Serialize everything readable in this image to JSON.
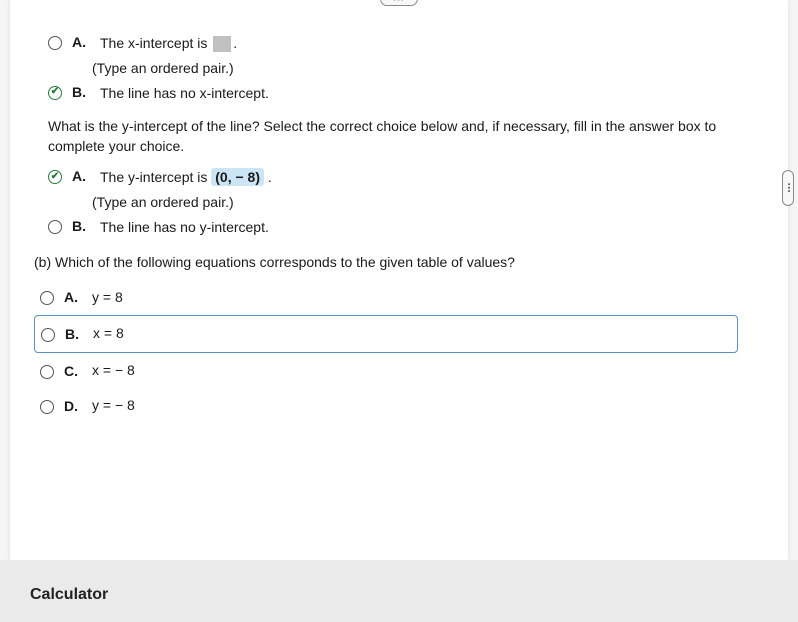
{
  "handles": {
    "top": "•••",
    "right": "•••"
  },
  "section_x": {
    "options": [
      {
        "letter": "A.",
        "text_prefix": "The x-intercept is",
        "text_suffix": ".",
        "hint": "(Type an ordered pair.)",
        "selected": false
      },
      {
        "letter": "B.",
        "text": "The line has no x-intercept.",
        "selected": true
      }
    ]
  },
  "question_y": "What is the y-intercept of the line? Select the correct choice below and, if necessary, fill in the answer box to complete your choice.",
  "section_y": {
    "options": [
      {
        "letter": "A.",
        "text_prefix": "The y-intercept is",
        "value": "(0, − 8)",
        "text_suffix": ".",
        "hint": "(Type an ordered pair.)",
        "selected": true
      },
      {
        "letter": "B.",
        "text": "The line has no y-intercept.",
        "selected": false
      }
    ]
  },
  "question_b": "(b) Which of the following equations corresponds to the given table of values?",
  "section_b": {
    "options": [
      {
        "letter": "A.",
        "text": "y = 8",
        "selected": false,
        "highlighted": false
      },
      {
        "letter": "B.",
        "text": "x = 8",
        "selected": false,
        "highlighted": true
      },
      {
        "letter": "C.",
        "text": "x = − 8",
        "selected": false,
        "highlighted": false
      },
      {
        "letter": "D.",
        "text": "y = − 8",
        "selected": false,
        "highlighted": false
      }
    ]
  },
  "footer": {
    "calculator": "Calculator"
  }
}
